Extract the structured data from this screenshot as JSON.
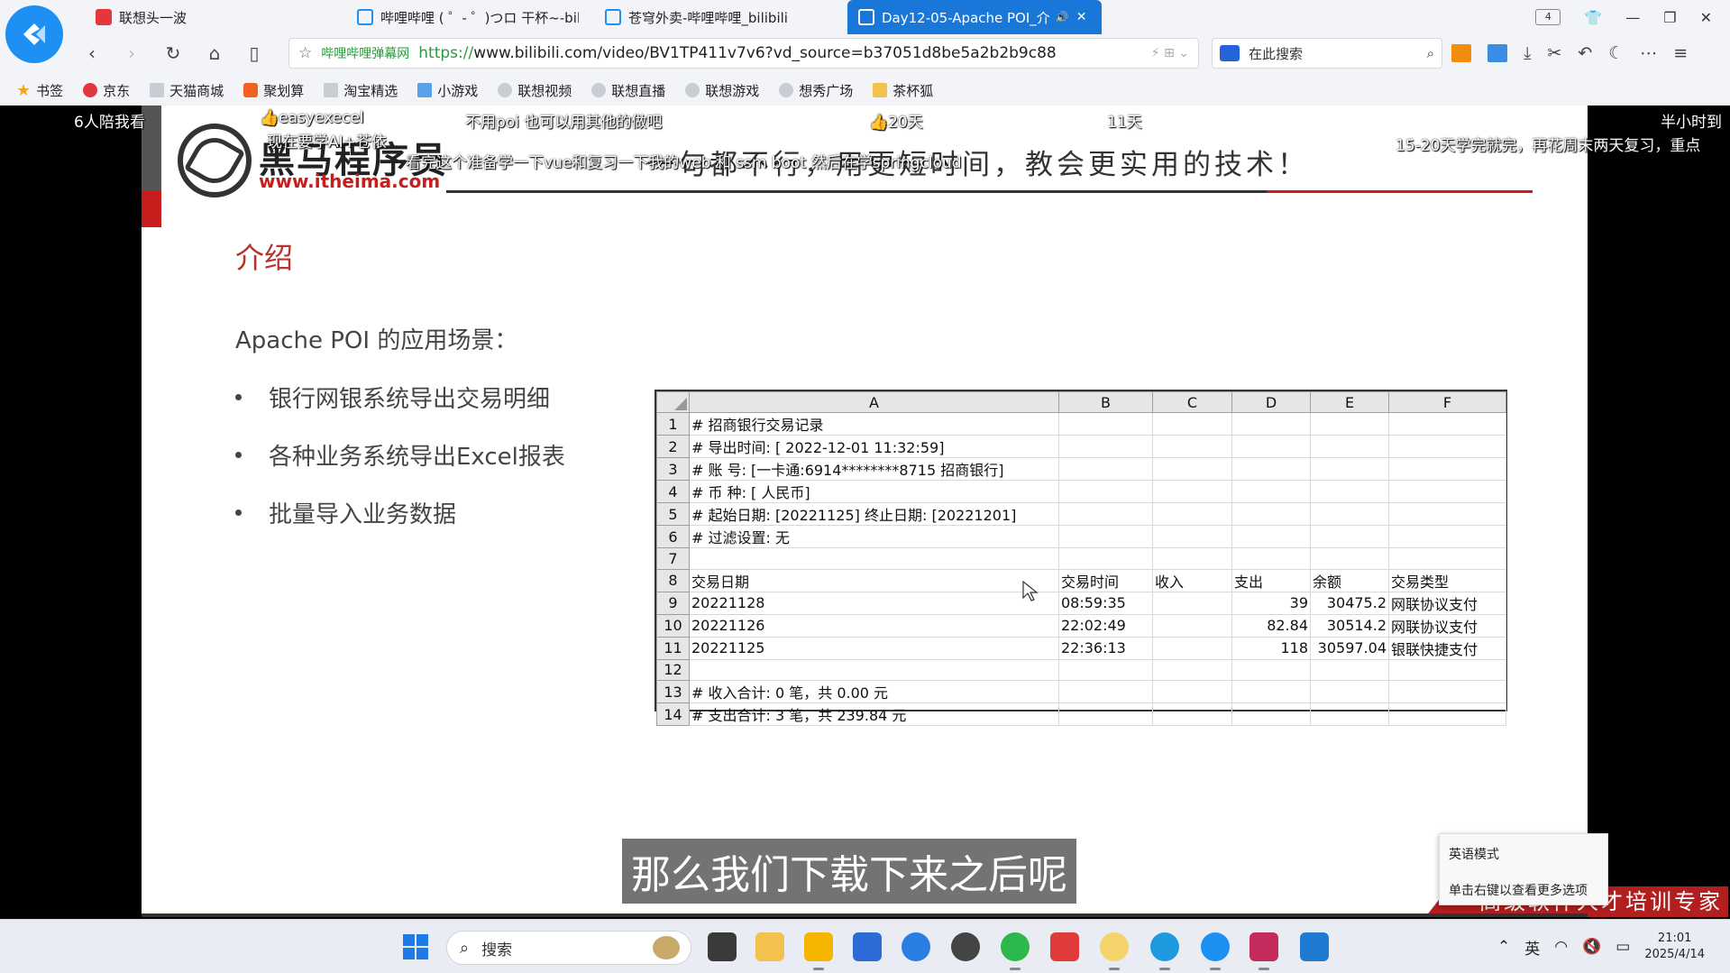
{
  "browser": {
    "tabs": [
      {
        "label": "联想头一波",
        "favicon": "red"
      },
      {
        "label": "哔哩哔哩 ( ゜- ゜)つロ 干杯~-bilib",
        "favicon": "bili"
      },
      {
        "label": "苍穹外卖-哔哩哔哩_bilibili",
        "favicon": "bili"
      },
      {
        "label": "Day12-05-Apache POI_介",
        "favicon": "bili",
        "active": true
      }
    ],
    "tab_count": "4",
    "address": {
      "site_label": "哔哩哔哩弹幕网",
      "url_scheme": "https://",
      "url_rest": "www.bilibili.com/video/BV1TP411v7v6?vd_source=b37051d8be5a2b2b9c88"
    },
    "search_placeholder": "在此搜索",
    "bookmarks": [
      "书签",
      "京东",
      "天猫商城",
      "聚划算",
      "淘宝精选",
      "小游戏",
      "联想视频",
      "联想直播",
      "联想游戏",
      "想秀广场",
      "茶杯狐"
    ]
  },
  "slide": {
    "brand_name": "黑马程序员",
    "brand_url": "www.itheima.com",
    "slogan": "一句都不行，用更短时间，教会更实用的技术！",
    "title": "介绍",
    "subtitle": "Apache POI 的应用场景：",
    "bullets": [
      "银行网银系统导出交易明细",
      "各种业务系统导出Excel报表",
      "批量导入业务数据"
    ],
    "sheet": {
      "columns": [
        "A",
        "B",
        "C",
        "D",
        "E",
        "F"
      ],
      "rows": [
        [
          "# 招商银行交易记录",
          "",
          "",
          "",
          "",
          ""
        ],
        [
          "# 导出时间: [           2022-12-01 11:32:59]",
          "",
          "",
          "",
          "",
          ""
        ],
        [
          "# 账    号: [一卡通:6914********8715   招商银行]",
          "",
          "",
          "",
          "",
          ""
        ],
        [
          "# 币    种: [                        人民币]",
          "",
          "",
          "",
          "",
          ""
        ],
        [
          "# 起始日期: [20221125]   终止日期: [20221201]",
          "",
          "",
          "",
          "",
          ""
        ],
        [
          "# 过滤设置: 无",
          "",
          "",
          "",
          "",
          ""
        ],
        [
          "",
          "",
          "",
          "",
          "",
          ""
        ],
        [
          "交易日期",
          "交易时间",
          "收入",
          "支出",
          "余额",
          "交易类型"
        ],
        [
          "20221128",
          "08:59:35",
          "",
          "39",
          "30475.2",
          "网联协议支付"
        ],
        [
          "20221126",
          "22:02:49",
          "",
          "82.84",
          "30514.2",
          "网联协议支付"
        ],
        [
          "20221125",
          "22:36:13",
          "",
          "118",
          "30597.04",
          "银联快捷支付"
        ],
        [
          "",
          "",
          "",
          "",
          "",
          ""
        ],
        [
          "# 收入合计: 0 笔，共 0.00 元",
          "",
          "",
          "",
          "",
          ""
        ],
        [
          "# 支出合计: 3 笔，共 239.84 元",
          "",
          "",
          "",
          "",
          ""
        ]
      ]
    },
    "banner": "高级软件人才培训专家"
  },
  "danmaku": [
    "6人陪我看",
    "👍easyexecel",
    "现在要学AI+苍依",
    "不用poi 也可以用其他的做吧",
    "👍20天",
    "11天",
    "半小时到",
    "看完这个准备学一下vue和复习一下我的web 和 ssm boot  然后在学springcloud",
    "15-20天学完就完，再花周末两天复习，重点"
  ],
  "subtitle_text": "那么我们下载下来之后呢",
  "ime_popup": {
    "line1": "英语模式",
    "line2": "单击右键以查看更多选项"
  },
  "taskbar": {
    "search_label": "搜索",
    "ime_indicator": "英",
    "time": "21:01",
    "date": "2025/4/14"
  }
}
